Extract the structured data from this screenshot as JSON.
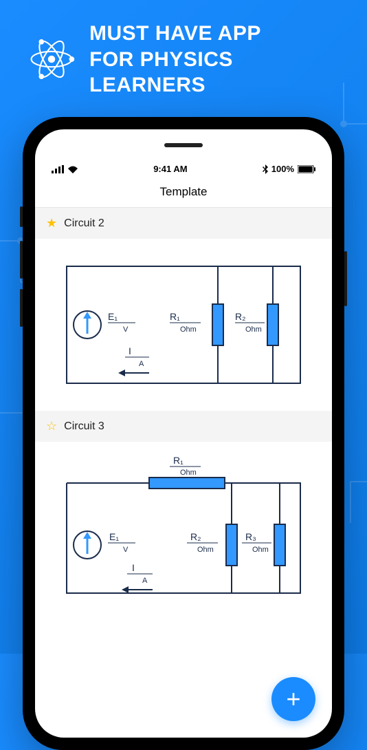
{
  "headline_line1": "MUST HAVE APP",
  "headline_line2": "FOR PHYSICS LEARNERS",
  "status_bar": {
    "time": "9:41 AM",
    "battery": "100%"
  },
  "nav": {
    "title": "Template"
  },
  "circuits": [
    {
      "title": "Circuit 2",
      "starred": true,
      "labels": {
        "E1": "E₁",
        "E1_unit": "V",
        "R1": "R₁",
        "R1_unit": "Ohm",
        "R2": "R₂",
        "R2_unit": "Ohm",
        "I": "I",
        "I_unit": "A"
      }
    },
    {
      "title": "Circuit 3",
      "starred": false,
      "labels": {
        "E1": "E₁",
        "E1_unit": "V",
        "R1": "R₁",
        "R1_unit": "Ohm",
        "R2": "R₂",
        "R2_unit": "Ohm",
        "R3": "R₃",
        "R3_unit": "Ohm",
        "I": "I",
        "I_unit": "A"
      }
    }
  ],
  "fab": {
    "label": "+"
  }
}
